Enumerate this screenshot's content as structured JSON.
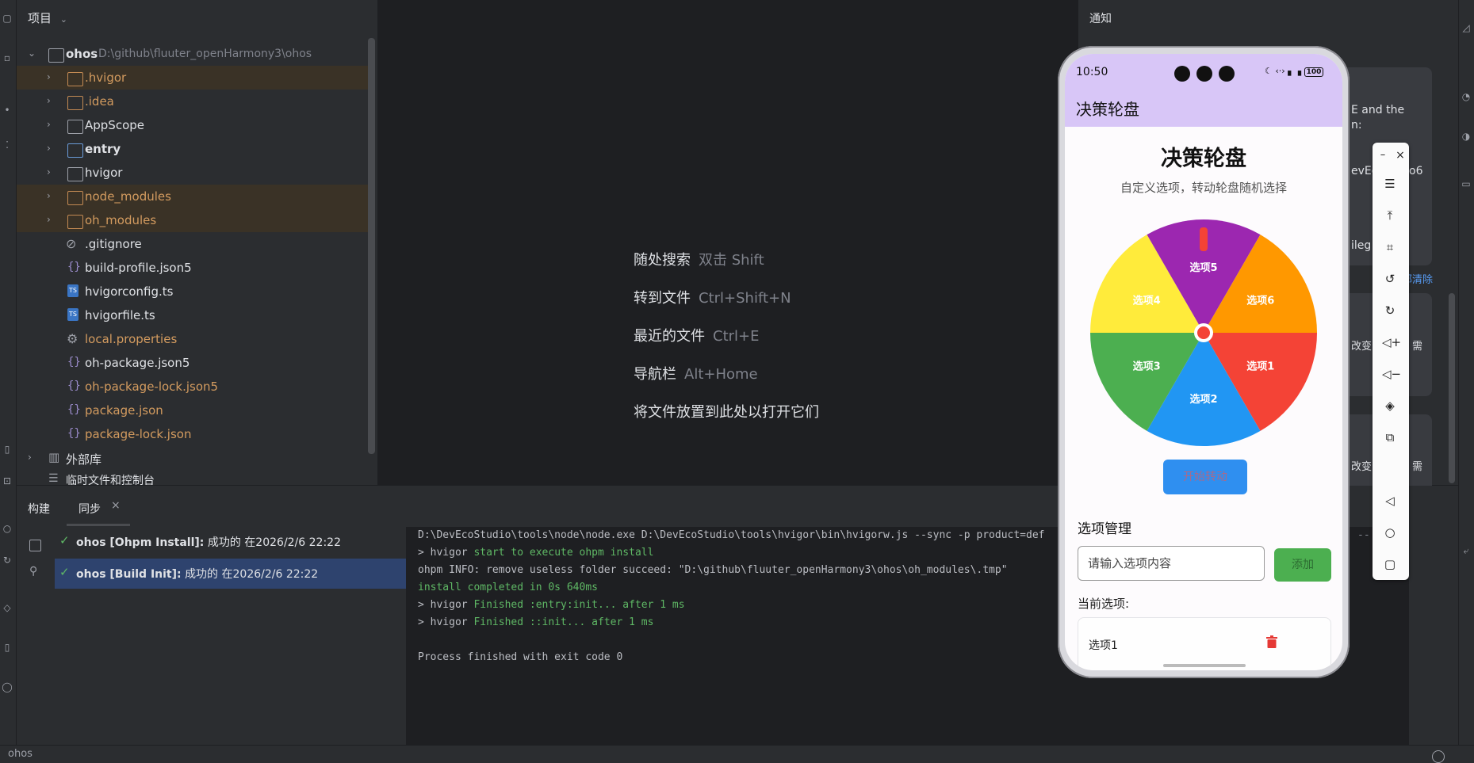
{
  "project": {
    "header": "项目",
    "root_name": "ohos",
    "root_path": "D:\\github\\fluuter_openHarmony3\\ohos",
    "items": [
      {
        "label": ".hvigor"
      },
      {
        "label": ".idea"
      },
      {
        "label": "AppScope"
      },
      {
        "label": "entry"
      },
      {
        "label": "hvigor"
      },
      {
        "label": "node_modules"
      },
      {
        "label": "oh_modules"
      },
      {
        "label": ".gitignore"
      },
      {
        "label": "build-profile.json5"
      },
      {
        "label": "hvigorconfig.ts"
      },
      {
        "label": "hvigorfile.ts"
      },
      {
        "label": "local.properties"
      },
      {
        "label": "oh-package.json5"
      },
      {
        "label": "oh-package-lock.json5"
      },
      {
        "label": "package.json"
      },
      {
        "label": "package-lock.json"
      },
      {
        "label": "外部库"
      },
      {
        "label": "临时文件和控制台"
      }
    ]
  },
  "editor": {
    "hints": [
      {
        "label": "随处搜索",
        "key": "双击 Shift"
      },
      {
        "label": "转到文件",
        "key": "Ctrl+Shift+N"
      },
      {
        "label": "最近的文件",
        "key": "Ctrl+E"
      },
      {
        "label": "导航栏",
        "key": "Alt+Home"
      },
      {
        "label": "将文件放置到此处以打开它们",
        "key": ""
      }
    ]
  },
  "notifications": {
    "title": "通知",
    "fragments": [
      "E and the",
      "n:",
      "evEc",
      "o6",
      "ileg",
      "部清除",
      "改变",
      "需",
      "改变",
      "需"
    ]
  },
  "build": {
    "tab_build": "构建",
    "tab_sync": "同步",
    "rows": [
      {
        "name": "ohos [Ohpm Install]:",
        "status": "成功的 在2026/2/6 22:22"
      },
      {
        "name": "ohos [Build Init]:",
        "status": "成功的 在2026/2/6 22:22"
      }
    ],
    "console": [
      {
        "prefix": "",
        "text": "D:\\DevEcoStudio\\tools\\node\\node.exe D:\\DevEcoStudio\\tools\\hvigor\\bin\\hvigorw.js --sync -p product=def"
      },
      {
        "prefix": "> hvigor ",
        "text": "start to execute ohpm install"
      },
      {
        "prefix": "",
        "text": "ohpm INFO: remove useless folder succeed: \"D:\\github\\fluuter_openHarmony3\\ohos\\oh_modules\\.tmp\""
      },
      {
        "prefix": "",
        "text": "install completed in 0s 640ms"
      },
      {
        "prefix": "> hvigor ",
        "text": "Finished :entry:init... after 1 ms"
      },
      {
        "prefix": "> hvigor ",
        "text": "Finished ::init... after 1 ms"
      },
      {
        "prefix": "",
        "text": ""
      },
      {
        "prefix": "",
        "text": "Process finished with exit code 0"
      }
    ],
    "trailing": "--"
  },
  "statusbar": {
    "text": "ohos"
  },
  "phone": {
    "time": "10:50",
    "battery": "100",
    "appbar_title": "决策轮盘",
    "title": "决策轮盘",
    "subtitle": "自定义选项，转动轮盘随机选择",
    "wheel_options": [
      {
        "label": "选项1",
        "color": "#f44336"
      },
      {
        "label": "选项2",
        "color": "#2196f3"
      },
      {
        "label": "选项3",
        "color": "#4caf50"
      },
      {
        "label": "选项4",
        "color": "#ffeb3b"
      },
      {
        "label": "选项5",
        "color": "#9c27b0"
      },
      {
        "label": "选项6",
        "color": "#ff9800"
      }
    ],
    "spin_button": "开始转动",
    "manage_title": "选项管理",
    "input_placeholder": "请输入选项内容",
    "add_button": "添加",
    "current_title": "当前选项:",
    "current_items": [
      "选项1"
    ]
  },
  "colors": {
    "accent": "#2f8ff0",
    "appbar": "#d8c6f7",
    "success": "#5fb865",
    "selection": "#2e436e"
  }
}
